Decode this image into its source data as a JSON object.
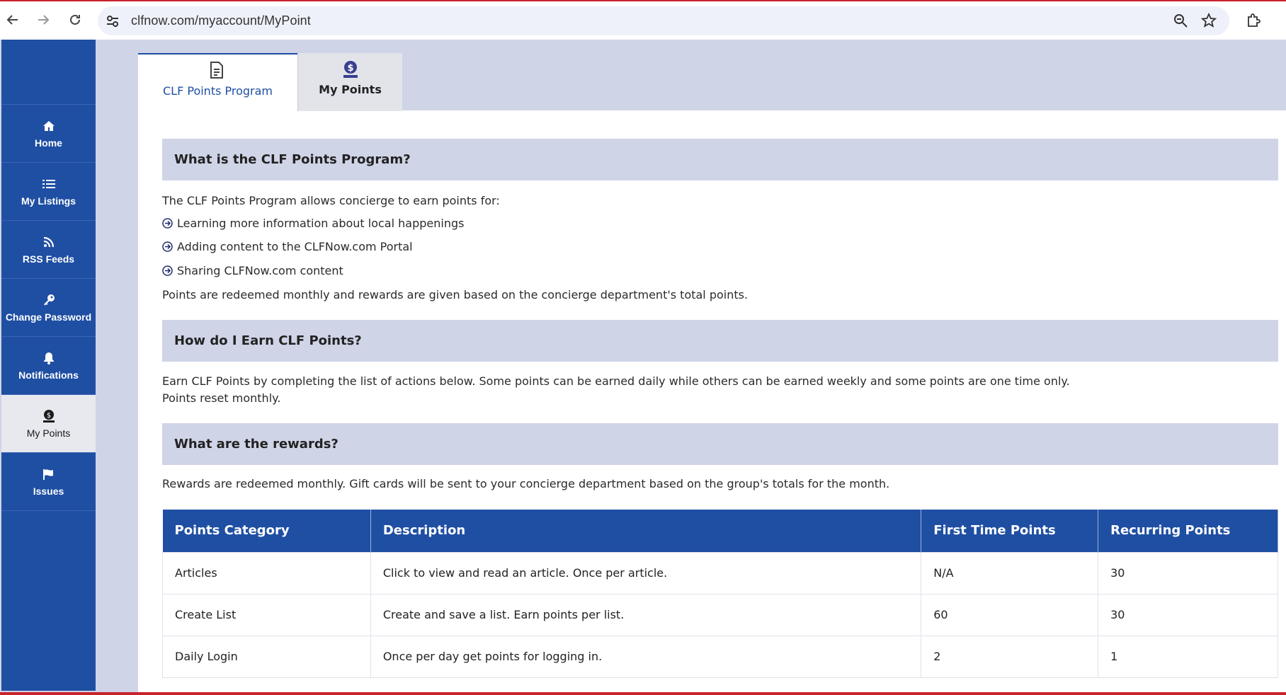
{
  "browser": {
    "url": "clfnow.com/myaccount/MyPoint"
  },
  "sidebar": {
    "items": [
      {
        "label": "Home",
        "icon": "home-icon"
      },
      {
        "label": "My Listings",
        "icon": "list-icon"
      },
      {
        "label": "RSS Feeds",
        "icon": "rss-icon"
      },
      {
        "label": "Change Password",
        "icon": "key-icon"
      },
      {
        "label": "Notifications",
        "icon": "bell-icon"
      },
      {
        "label": "My Points",
        "icon": "points-icon",
        "active": true
      },
      {
        "label": "Issues",
        "icon": "flag-icon"
      }
    ]
  },
  "tabs": [
    {
      "label": "CLF Points Program",
      "active": true
    },
    {
      "label": "My Points",
      "active": false
    }
  ],
  "sections": {
    "what": {
      "heading": "What is the CLF Points Program?",
      "intro": "The CLF Points Program allows concierge to earn points for:",
      "bullets": [
        "Learning more information about local happenings",
        "Adding content to the CLFNow.com Portal",
        "Sharing CLFNow.com content"
      ],
      "note": "Points are redeemed monthly and rewards are given based on the concierge department's total points."
    },
    "earn": {
      "heading": "How do I Earn CLF Points?",
      "line1": "Earn CLF Points by completing the list of actions below. Some points can be earned daily while others can be earned weekly and some points are one time only.",
      "line2": "Points reset monthly."
    },
    "rewards": {
      "heading": "What are the rewards?",
      "text": "Rewards are redeemed monthly. Gift cards will be sent to your concierge department based on the group's totals for the month."
    }
  },
  "table": {
    "headers": [
      "Points Category",
      "Description",
      "First Time Points",
      "Recurring Points"
    ],
    "rows": [
      [
        "Articles",
        "Click to view and read an article. Once per article.",
        "N/A",
        "30"
      ],
      [
        "Create List",
        "Create and save a list. Earn points per list.",
        "60",
        "30"
      ],
      [
        "Daily Login",
        "Once per day get points for logging in.",
        "2",
        "1"
      ]
    ]
  },
  "colors": {
    "accent": "#1f4fa3",
    "section_bg": "#d0d4e7",
    "page_bg": "#cfd4e6"
  }
}
